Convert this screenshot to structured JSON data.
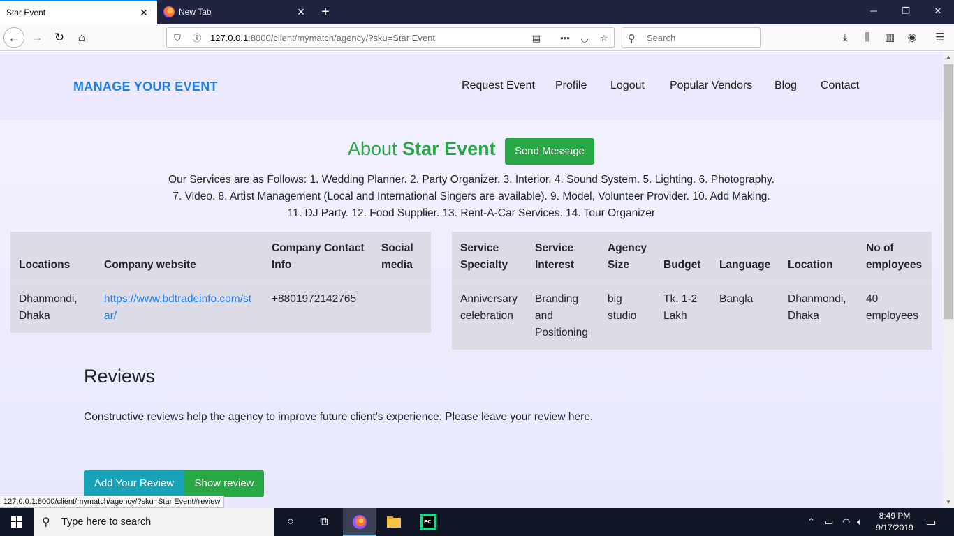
{
  "browser": {
    "tabs": [
      {
        "title": "Star Event"
      },
      {
        "title": "New Tab"
      }
    ],
    "url_host": "127.0.0.1",
    "url_rest": ":8000/client/mymatch/agency/?sku=Star Event",
    "search_placeholder": "Search",
    "status_url": "127.0.0.1:8000/client/mymatch/agency/?sku=Star Event#review"
  },
  "site": {
    "brand": "MANAGE YOUR EVENT",
    "menu": [
      "Request Event",
      "Profile",
      "Logout",
      "Popular Vendors",
      "Blog",
      "Contact"
    ]
  },
  "about": {
    "prefix": "About",
    "name": "Star Event",
    "send_button": "Send Message",
    "services": "Our Services are as Follows: 1. Wedding Planner. 2. Party Organizer. 3. Interior. 4. Sound System. 5. Lighting. 6. Photography. 7. Video. 8. Artist Management (Local and International Singers are available). 9. Model, Volunteer Provider. 10. Add Making. 11. DJ Party. 12. Food Supplier. 13. Rent-A-Car Services. 14. Tour Organizer"
  },
  "company_table": {
    "headers": [
      "Locations",
      "Company website",
      "Company Contact Info",
      "Social media"
    ],
    "row": [
      "Dhanmondi, Dhaka",
      "https://www.bdtradeinfo.com/star/",
      "+8801972142765",
      ""
    ]
  },
  "agency_table": {
    "headers": [
      "Service Specialty",
      "Service Interest",
      "Agency Size",
      "Budget",
      "Language",
      "Location",
      "No of employees"
    ],
    "row": [
      "Anniversary celebration",
      "Branding and Positioning",
      "big studio",
      "Tk. 1-2 Lakh",
      "Bangla",
      "Dhanmondi, Dhaka",
      "40 employees"
    ]
  },
  "reviews": {
    "heading": "Reviews",
    "text": "Constructive reviews help the agency to improve future client's experience. Please leave your review here.",
    "add_button": "Add Your Review",
    "show_button": "Show review"
  },
  "taskbar": {
    "search_placeholder": "Type here to search",
    "time": "8:49 PM",
    "date": "9/17/2019"
  }
}
